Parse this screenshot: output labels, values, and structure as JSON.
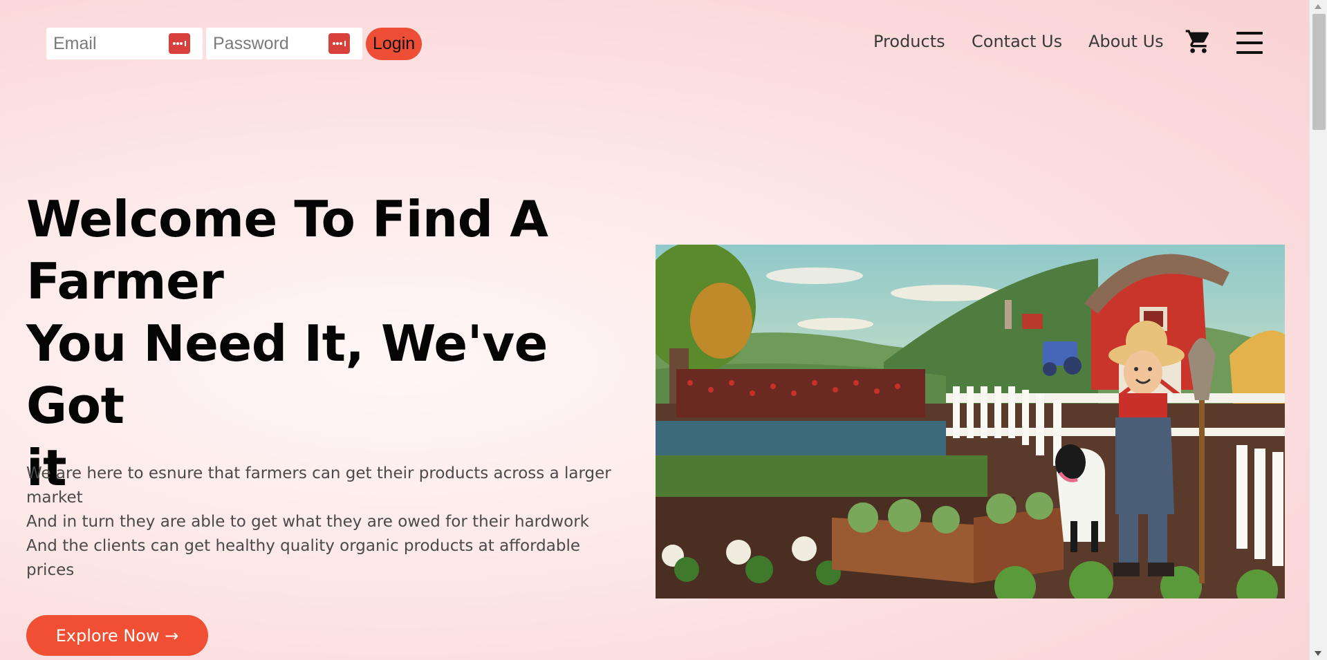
{
  "login": {
    "email_placeholder": "Email",
    "password_placeholder": "Password",
    "login_label": "Login"
  },
  "nav": {
    "products": "Products",
    "contact": "Contact Us",
    "about": "About Us"
  },
  "icons": {
    "cart": "shopping-cart-icon",
    "menu": "hamburger-menu-icon",
    "password_manager": "password-manager-icon"
  },
  "hero": {
    "title_line1": "Welcome To Find A",
    "title_line2": "Farmer",
    "title_line3": "You Need It, We've Got",
    "title_line4": "it",
    "desc_line1": "We are here to esnure that farmers can get their products across a larger",
    "desc_line2": "market",
    "desc_line3": "And in turn they are able to get what they are owed for their hardwork",
    "desc_line4": "And the clients can get healthy quality organic products at affordable",
    "desc_line5": "prices",
    "cta_label": "Explore Now →"
  },
  "colors": {
    "accent": "#f04f33",
    "pw_badge": "#d8403c",
    "background": "#fbd9da"
  }
}
